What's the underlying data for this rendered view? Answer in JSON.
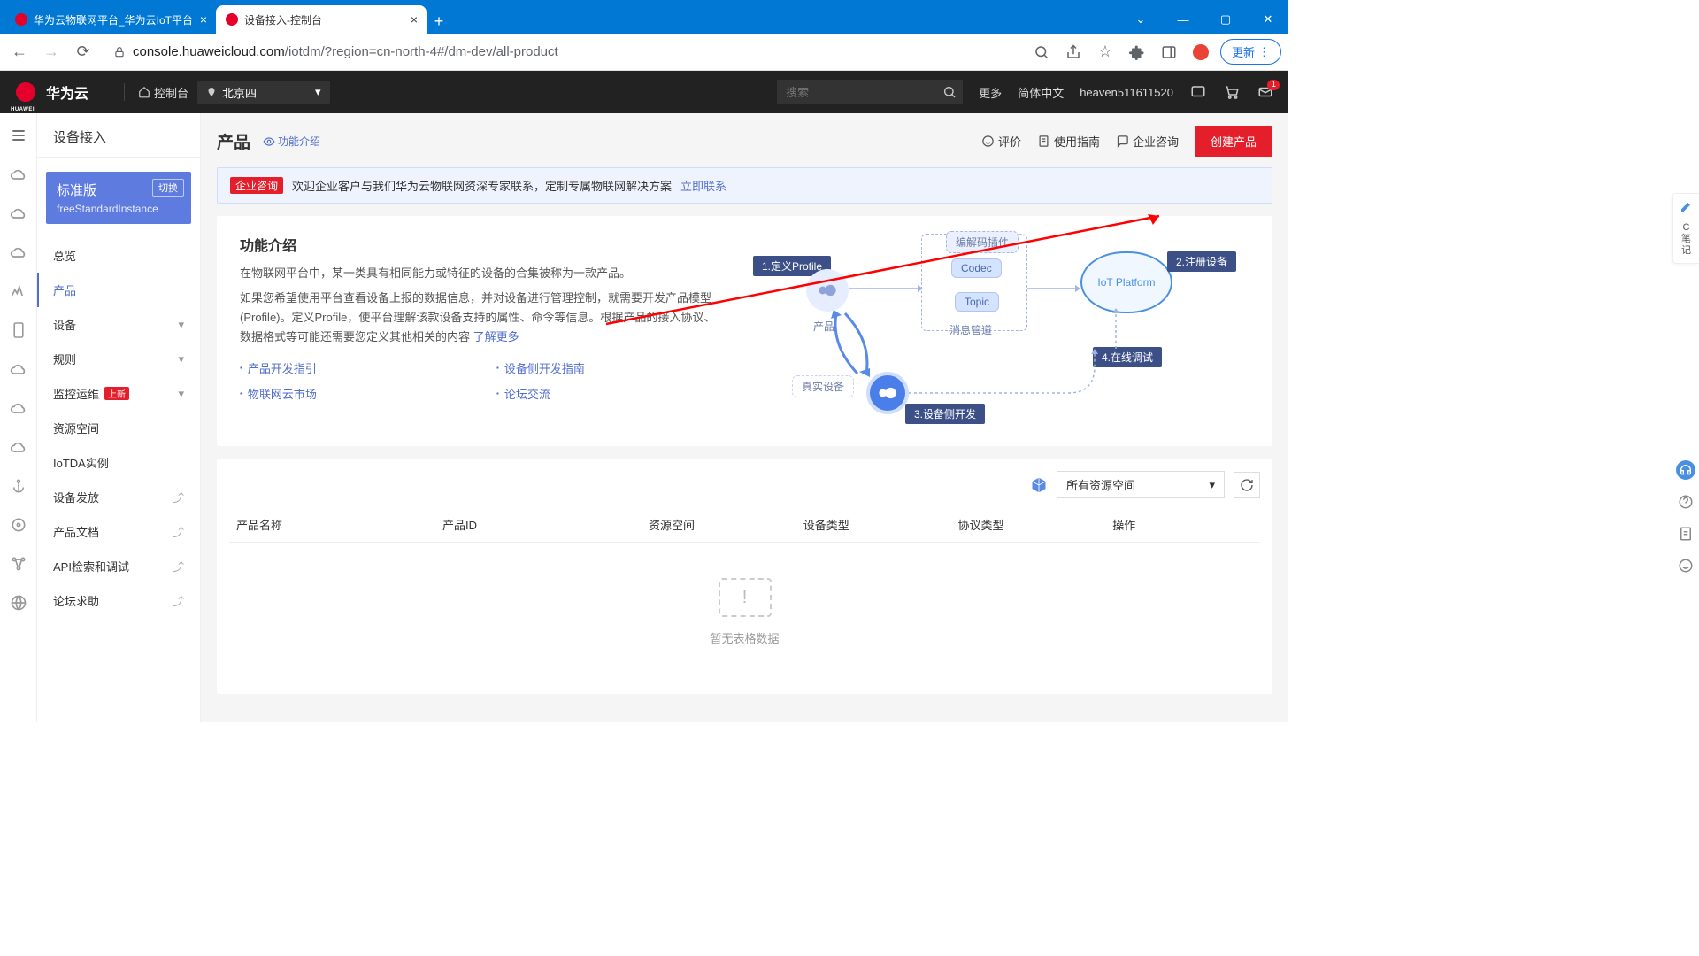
{
  "browser": {
    "tab1_title": "华为云物联网平台_华为云IoT平台",
    "tab2_title": "设备接入-控制台",
    "url_domain": "console.huaweicloud.com",
    "url_path": "/iotdm/?region=cn-north-4#/dm-dev/all-product",
    "update_label": "更新"
  },
  "hwbar": {
    "brand": "华为云",
    "console": "控制台",
    "region": "北京四",
    "search_placeholder": "搜索",
    "more": "更多",
    "lang": "简体中文",
    "user": "heaven511611520"
  },
  "sidebar": {
    "title": "设备接入",
    "instance_version": "标准版",
    "instance_switch": "切换",
    "instance_name": "freeStandardInstance",
    "items": [
      "总览",
      "产品",
      "设备",
      "规则",
      "监控运维",
      "资源空间",
      "IoTDA实例",
      "设备发放",
      "产品文档",
      "API检索和调试",
      "论坛求助"
    ],
    "new_tag": "上新"
  },
  "page": {
    "title": "产品",
    "func_intro_link": "功能介绍",
    "rate": "评价",
    "guide": "使用指南",
    "enterprise": "企业咨询",
    "create": "创建产品"
  },
  "alert": {
    "tag": "企业咨询",
    "text": "欢迎企业客户与我们华为云物联网资深专家联系，定制专属物联网解决方案",
    "link": "立即联系"
  },
  "intro": {
    "heading": "功能介绍",
    "p1": "在物联网平台中，某一类具有相同能力或特征的设备的合集被称为一款产品。",
    "p2": "如果您希望使用平台查看设备上报的数据信息，并对设备进行管理控制，就需要开发产品模型 (Profile)。定义Profile，使平台理解该款设备支持的属性、命令等信息。根据产品的接入协议、数据格式等可能还需要您定义其他相关的内容",
    "learn_more": "了解更多",
    "links": [
      "产品开发指引",
      "设备侧开发指南",
      "物联网云市场",
      "论坛交流"
    ]
  },
  "diagram": {
    "step1": "1.定义Profile",
    "step2": "2.注册设备",
    "step3": "3.设备侧开发",
    "step4": "4.在线调试",
    "codec": "Codec",
    "topic": "Topic",
    "codec_plugin": "编解码插件",
    "msg_channel": "消息管道",
    "product": "产品",
    "real_device": "真实设备",
    "platform": "IoT Platform"
  },
  "table": {
    "select_label": "所有资源空间",
    "headers": [
      "产品名称",
      "产品ID",
      "资源空间",
      "设备类型",
      "协议类型",
      "操作"
    ],
    "empty": "暂无表格数据"
  },
  "float": {
    "note": "C\n笔\n记"
  }
}
